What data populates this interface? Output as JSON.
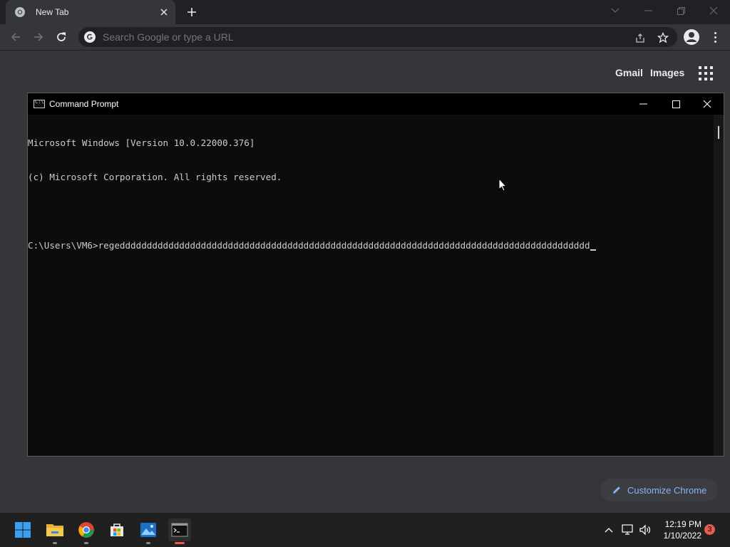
{
  "browser": {
    "tab_title": "New Tab",
    "omnibox_placeholder": "Search Google or type a URL",
    "ntp_links": [
      "Gmail",
      "Images"
    ],
    "customize_label": "Customize Chrome",
    "accent_color": "#8ab4f8"
  },
  "cmd": {
    "title": "Command Prompt",
    "lines": [
      "Microsoft Windows [Version 10.0.22000.376]",
      "(c) Microsoft Corporation. All rights reserved.",
      "",
      "C:\\Users\\VM6>regeddddddddddddddddddddddddddddddddddddddddddddddddddddddddddddddddddddddddddddddddddddddd"
    ]
  },
  "taskbar": {
    "items": [
      "windows-start-icon",
      "file-explorer-icon",
      "chrome-icon",
      "microsoft-store-icon",
      "photos-icon",
      "terminal-icon"
    ],
    "clock_time": "12:19 PM",
    "clock_date": "1/10/2022",
    "notification_count": "3"
  }
}
